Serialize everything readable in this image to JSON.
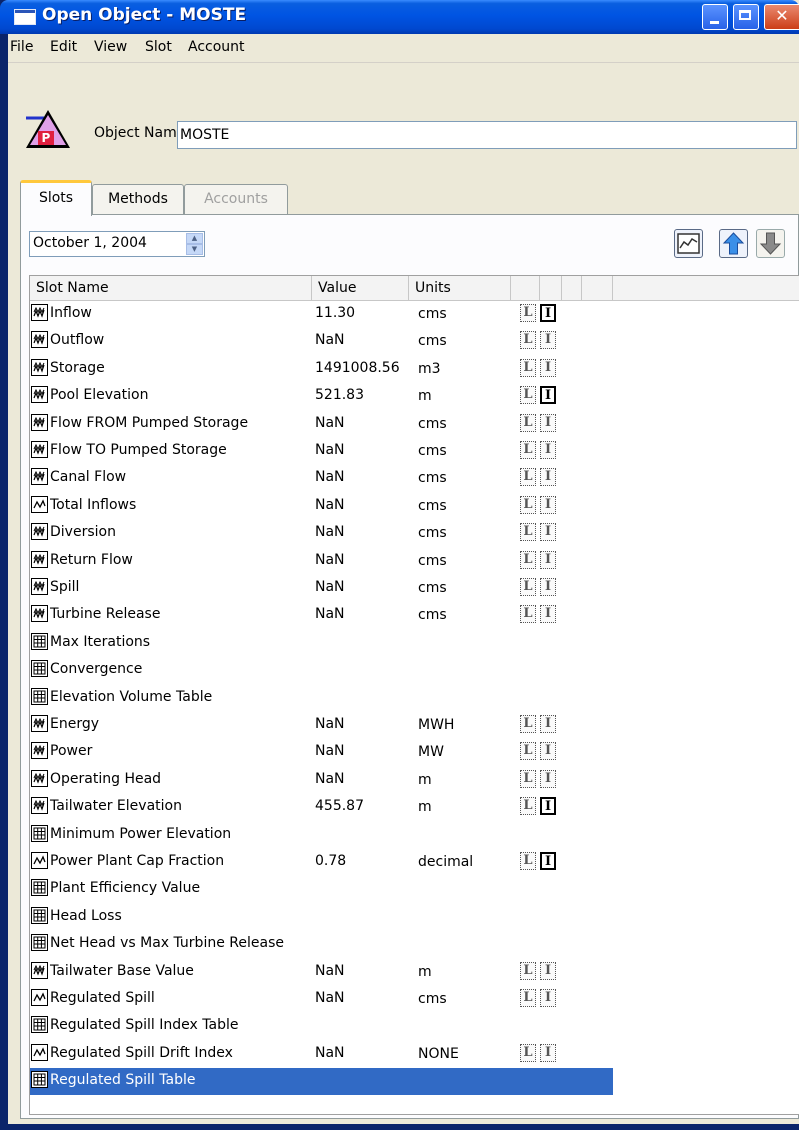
{
  "window": {
    "title": "Open Object - MOSTE",
    "menu": [
      "File",
      "Edit",
      "View",
      "Slot",
      "Account"
    ]
  },
  "object": {
    "icon_letter": "P",
    "name_label": "Object Name:",
    "name_value": "MOSTE"
  },
  "tabs": [
    {
      "label": "Slots",
      "active": true
    },
    {
      "label": "Methods",
      "active": false
    },
    {
      "label": "Accounts",
      "active": false,
      "disabled": true
    }
  ],
  "date": "October 1, 2004",
  "toolbar": [
    "plot-icon",
    "up-arrow-icon",
    "down-arrow-icon"
  ],
  "table": {
    "headers": {
      "name": "Slot Name",
      "value": "Value",
      "units": "Units"
    },
    "rows": [
      {
        "icon": "series-icon",
        "name": "Inflow",
        "value": "11.30",
        "units": "cms",
        "flags": true,
        "i_active": true
      },
      {
        "icon": "series-icon",
        "name": "Outflow",
        "value": "NaN",
        "units": "cms",
        "flags": true,
        "i_active": false
      },
      {
        "icon": "series-icon",
        "name": "Storage",
        "value": "1491008.56",
        "units": "m3",
        "flags": true,
        "i_active": false
      },
      {
        "icon": "series-icon",
        "name": "Pool Elevation",
        "value": "521.83",
        "units": "m",
        "flags": true,
        "i_active": true
      },
      {
        "icon": "series-icon",
        "name": "Flow FROM Pumped Storage",
        "value": "NaN",
        "units": "cms",
        "flags": true,
        "i_active": false
      },
      {
        "icon": "series-icon",
        "name": "Flow TO Pumped Storage",
        "value": "NaN",
        "units": "cms",
        "flags": true,
        "i_active": false
      },
      {
        "icon": "series-icon",
        "name": "Canal Flow",
        "value": "NaN",
        "units": "cms",
        "flags": true,
        "i_active": false
      },
      {
        "icon": "agg-series-icon",
        "name": "Total Inflows",
        "value": "NaN",
        "units": "cms",
        "flags": true,
        "i_active": false
      },
      {
        "icon": "series-icon",
        "name": "Diversion",
        "value": "NaN",
        "units": "cms",
        "flags": true,
        "i_active": false
      },
      {
        "icon": "series-icon",
        "name": "Return Flow",
        "value": "NaN",
        "units": "cms",
        "flags": true,
        "i_active": false
      },
      {
        "icon": "series-icon",
        "name": "Spill",
        "value": "NaN",
        "units": "cms",
        "flags": true,
        "i_active": false
      },
      {
        "icon": "series-icon",
        "name": "Turbine Release",
        "value": "NaN",
        "units": "cms",
        "flags": true,
        "i_active": false
      },
      {
        "icon": "table-icon",
        "name": "Max Iterations",
        "value": "",
        "units": "",
        "flags": false,
        "i_active": false
      },
      {
        "icon": "table-icon",
        "name": "Convergence",
        "value": "",
        "units": "",
        "flags": false,
        "i_active": false
      },
      {
        "icon": "table-icon",
        "name": "Elevation Volume Table",
        "value": "",
        "units": "",
        "flags": false,
        "i_active": false
      },
      {
        "icon": "series-icon",
        "name": "Energy",
        "value": "NaN",
        "units": "MWH",
        "flags": true,
        "i_active": false
      },
      {
        "icon": "series-icon",
        "name": "Power",
        "value": "NaN",
        "units": "MW",
        "flags": true,
        "i_active": false
      },
      {
        "icon": "series-icon",
        "name": "Operating Head",
        "value": "NaN",
        "units": "m",
        "flags": true,
        "i_active": false
      },
      {
        "icon": "series-icon",
        "name": "Tailwater Elevation",
        "value": "455.87",
        "units": "m",
        "flags": true,
        "i_active": true
      },
      {
        "icon": "table-icon",
        "name": "Minimum Power Elevation",
        "value": "",
        "units": "",
        "flags": false,
        "i_active": false
      },
      {
        "icon": "agg-series-icon",
        "name": "Power Plant Cap Fraction",
        "value": "0.78",
        "units": "decimal",
        "flags": true,
        "i_active": true
      },
      {
        "icon": "table-icon",
        "name": "Plant Efficiency Value",
        "value": "",
        "units": "",
        "flags": false,
        "i_active": false
      },
      {
        "icon": "table-icon",
        "name": "Head Loss",
        "value": "",
        "units": "",
        "flags": false,
        "i_active": false
      },
      {
        "icon": "table-icon",
        "name": "Net Head vs Max Turbine Release",
        "value": "",
        "units": "",
        "flags": false,
        "i_active": false
      },
      {
        "icon": "series-icon",
        "name": "Tailwater Base Value",
        "value": "NaN",
        "units": "m",
        "flags": true,
        "i_active": false
      },
      {
        "icon": "agg-series-icon",
        "name": "Regulated Spill",
        "value": "NaN",
        "units": "cms",
        "flags": true,
        "i_active": false
      },
      {
        "icon": "table-icon",
        "name": "Regulated Spill Index Table",
        "value": "",
        "units": "",
        "flags": false,
        "i_active": false
      },
      {
        "icon": "agg-series-icon",
        "name": "Regulated Spill Drift Index",
        "value": "NaN",
        "units": "NONE",
        "flags": true,
        "i_active": false
      },
      {
        "icon": "table-icon",
        "name": "Regulated Spill Table",
        "value": "",
        "units": "",
        "flags": false,
        "i_active": false,
        "selected": true
      }
    ]
  },
  "colors": {
    "titlebar": "#0054E3",
    "selection": "#316AC5",
    "face": "#ECE9D8"
  }
}
